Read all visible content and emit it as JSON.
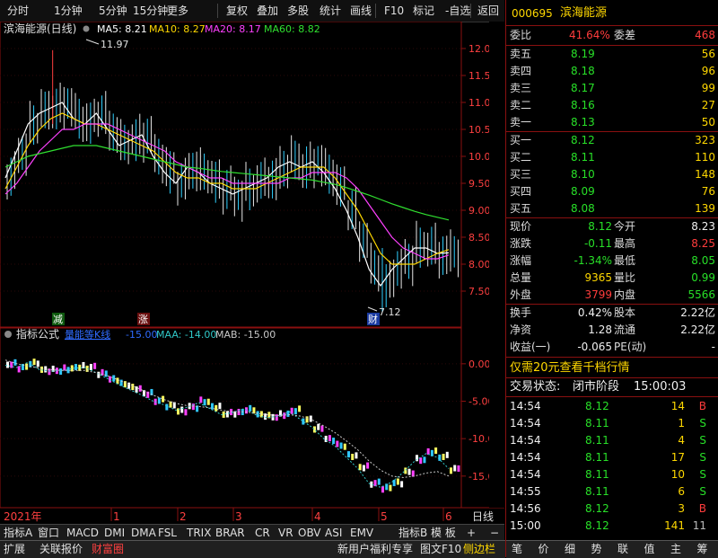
{
  "toolbar": {
    "items": [
      "分时",
      "1分钟",
      "5分钟",
      "15分钟",
      "更多",
      "复权",
      "叠加",
      "多股",
      "统计",
      "画线",
      "F10",
      "标记",
      "-自选",
      "返回"
    ]
  },
  "main_chart": {
    "title": "滨海能源(日线)",
    "ma": [
      {
        "label": "MA5: 8.21",
        "color": "#ffffff"
      },
      {
        "label": "MA10: 8.27",
        "color": "#ffd800"
      },
      {
        "label": "MA20: 8.17",
        "color": "#ff40ff"
      },
      {
        "label": "MA60: 8.82",
        "color": "#30e030"
      }
    ],
    "high_label": "11.97",
    "low_label": "7.12",
    "y_ticks": [
      "12.00",
      "11.50",
      "11.00",
      "10.50",
      "10.00",
      "9.50",
      "9.00",
      "8.50",
      "8.00",
      "7.50"
    ],
    "markers": {
      "jian": "减",
      "zhang": "涨",
      "cai": "财"
    }
  },
  "indicator_chart": {
    "title": "指标公式",
    "name": "量能等K线",
    "vals": [
      {
        "label": "-15.00",
        "color": "#2f6bff"
      },
      {
        "label": "MAA: -14.00",
        "color": "#30c8c8"
      },
      {
        "label": "MAB: -15.00",
        "color": "#c8c8c8"
      }
    ],
    "y_ticks": [
      "0.00",
      "-5.00",
      "-10.00",
      "-15.00"
    ]
  },
  "time_axis": {
    "year": "2021年",
    "months": [
      "1",
      "2",
      "3",
      "4",
      "5",
      "6"
    ],
    "right": "日线"
  },
  "bottom_tabs": [
    "指标A",
    "窗口",
    "MACD",
    "DMI",
    "DMA",
    "FSL",
    "TRIX",
    "BRAR",
    "CR",
    "VR",
    "OBV",
    "ASI",
    "EMV",
    "指标B",
    "模 板",
    "+",
    "−"
  ],
  "quote": {
    "code": "000695",
    "name": "滨海能源",
    "weibi_label": "委比",
    "weibi": "41.64%",
    "weicha_label": "委差",
    "weicha": "468",
    "sell": [
      {
        "label": "卖五",
        "price": "8.19",
        "vol": "56"
      },
      {
        "label": "卖四",
        "price": "8.18",
        "vol": "96"
      },
      {
        "label": "卖三",
        "price": "8.17",
        "vol": "99"
      },
      {
        "label": "卖二",
        "price": "8.16",
        "vol": "27"
      },
      {
        "label": "卖一",
        "price": "8.13",
        "vol": "50"
      }
    ],
    "buy": [
      {
        "label": "买一",
        "price": "8.12",
        "vol": "323"
      },
      {
        "label": "买二",
        "price": "8.11",
        "vol": "110"
      },
      {
        "label": "买三",
        "price": "8.10",
        "vol": "148"
      },
      {
        "label": "买四",
        "price": "8.09",
        "vol": "76"
      },
      {
        "label": "买五",
        "price": "8.08",
        "vol": "139"
      }
    ],
    "stats": [
      {
        "l1": "现价",
        "v1": "8.12",
        "c1": "green",
        "l2": "今开",
        "v2": "8.23",
        "c2": "white"
      },
      {
        "l1": "涨跌",
        "v1": "-0.11",
        "c1": "green",
        "l2": "最高",
        "v2": "8.25",
        "c2": "red"
      },
      {
        "l1": "涨幅",
        "v1": "-1.34%",
        "c1": "green",
        "l2": "最低",
        "v2": "8.05",
        "c2": "green"
      },
      {
        "l1": "总量",
        "v1": "9365",
        "c1": "yellow",
        "l2": "量比",
        "v2": "0.99",
        "c2": "green"
      },
      {
        "l1": "外盘",
        "v1": "3799",
        "c1": "red",
        "l2": "内盘",
        "v2": "5566",
        "c2": "green"
      }
    ],
    "fin": [
      {
        "l1": "换手",
        "v1": "0.42%",
        "l2": "股本",
        "v2": "2.22亿"
      },
      {
        "l1": "净资",
        "v1": "1.28",
        "l2": "流通",
        "v2": "2.22亿"
      },
      {
        "l1": "收益(一)",
        "v1": "-0.065",
        "l2": "PE(动)",
        "v2": "-"
      }
    ],
    "promo": "仅需20元查看千档行情",
    "trade_status_label": "交易状态:",
    "trade_status": "闭市阶段",
    "trade_time": "15:00:03",
    "ticks": [
      {
        "t": "14:54",
        "p": "8.12",
        "v": "14",
        "bs": "B"
      },
      {
        "t": "14:54",
        "p": "8.11",
        "v": "1",
        "bs": "S"
      },
      {
        "t": "14:54",
        "p": "8.11",
        "v": "4",
        "bs": "S"
      },
      {
        "t": "14:54",
        "p": "8.11",
        "v": "17",
        "bs": "S"
      },
      {
        "t": "14:54",
        "p": "8.11",
        "v": "10",
        "bs": "S"
      },
      {
        "t": "14:55",
        "p": "8.11",
        "v": "6",
        "bs": "S"
      },
      {
        "t": "14:56",
        "p": "8.12",
        "v": "3",
        "bs": "B"
      },
      {
        "t": "15:00",
        "p": "8.12",
        "v": "141",
        "bs": "11"
      }
    ],
    "bottom_icons": [
      "笔",
      "价",
      "细",
      "势",
      "联",
      "值",
      "主",
      "筹"
    ]
  },
  "status_bar": {
    "left": [
      "扩展",
      "关联报价",
      "财富圈"
    ],
    "right": [
      "新用户福利专享",
      "图文F10",
      "侧边栏"
    ]
  },
  "chart_data": [
    {
      "type": "line",
      "title": "滨海能源(日线)",
      "series": [
        {
          "name": "MA5",
          "values": [
            9.6,
            10.1,
            10.6,
            10.8,
            10.9,
            11.0,
            10.7,
            10.6,
            10.8,
            10.5,
            10.2,
            10.3,
            10.4,
            10.0,
            9.7,
            9.5,
            9.8,
            9.7,
            9.5,
            9.4,
            9.3,
            9.4,
            9.5,
            9.6,
            9.8,
            9.9,
            9.8,
            9.9,
            9.7,
            9.4,
            9.0,
            8.5,
            7.9,
            7.6,
            7.9,
            8.1,
            8.3,
            8.3,
            8.2,
            8.21
          ]
        },
        {
          "name": "MA10",
          "values": [
            9.4,
            9.8,
            10.2,
            10.5,
            10.7,
            10.8,
            10.7,
            10.6,
            10.6,
            10.5,
            10.4,
            10.3,
            10.2,
            10.1,
            9.9,
            9.7,
            9.6,
            9.6,
            9.5,
            9.5,
            9.4,
            9.4,
            9.4,
            9.5,
            9.6,
            9.7,
            9.8,
            9.8,
            9.8,
            9.6,
            9.3,
            9.0,
            8.6,
            8.2,
            8.0,
            8.0,
            8.0,
            8.1,
            8.2,
            8.27
          ]
        },
        {
          "name": "MA20",
          "values": [
            9.3,
            9.5,
            9.8,
            10.1,
            10.3,
            10.5,
            10.5,
            10.6,
            10.6,
            10.6,
            10.5,
            10.4,
            10.3,
            10.2,
            10.1,
            9.9,
            9.8,
            9.7,
            9.6,
            9.6,
            9.5,
            9.5,
            9.5,
            9.5,
            9.5,
            9.6,
            9.6,
            9.7,
            9.7,
            9.7,
            9.6,
            9.4,
            9.1,
            8.8,
            8.5,
            8.3,
            8.2,
            8.1,
            8.1,
            8.17
          ]
        },
        {
          "name": "MA60",
          "values": [
            9.8,
            9.9,
            10.0,
            10.05,
            10.1,
            10.15,
            10.2,
            10.2,
            10.2,
            10.15,
            10.1,
            10.05,
            10.0,
            9.95,
            9.9,
            9.85,
            9.8,
            9.78,
            9.75,
            9.72,
            9.7,
            9.68,
            9.66,
            9.64,
            9.62,
            9.6,
            9.58,
            9.56,
            9.52,
            9.48,
            9.42,
            9.35,
            9.28,
            9.2,
            9.12,
            9.05,
            8.98,
            8.92,
            8.87,
            8.82
          ]
        }
      ],
      "ylim": [
        7.0,
        12.2
      ],
      "annotations": [
        "11.97",
        "7.12"
      ]
    },
    {
      "type": "line",
      "title": "量能等K线",
      "series": [
        {
          "name": "MAA",
          "values": [
            -0.2,
            -0.5,
            0.2,
            -0.8,
            -1.0,
            -0.9,
            -0.6,
            -0.5,
            -1.2,
            -2.0,
            -2.8,
            -3.5,
            -4.2,
            -5.0,
            -5.5,
            -6.2,
            -5.8,
            -5.2,
            -6.0,
            -6.8,
            -6.5,
            -6.0,
            -6.8,
            -7.2,
            -7.0,
            -6.4,
            -7.5,
            -8.5,
            -10.0,
            -11.0,
            -12.5,
            -14.0,
            -16.0,
            -16.5,
            -15.8,
            -14.5,
            -13.0,
            -12.0,
            -12.5,
            -14.0
          ]
        },
        {
          "name": "MAB",
          "values": [
            0.5,
            0.0,
            -0.3,
            -0.6,
            -0.8,
            -0.9,
            -0.9,
            -0.9,
            -1.2,
            -1.6,
            -2.2,
            -2.8,
            -3.5,
            -4.2,
            -4.8,
            -5.3,
            -5.6,
            -5.7,
            -5.9,
            -6.2,
            -6.4,
            -6.4,
            -6.6,
            -6.8,
            -6.9,
            -6.8,
            -7.0,
            -7.5,
            -8.3,
            -9.2,
            -10.3,
            -11.5,
            -13.0,
            -14.2,
            -15.0,
            -15.2,
            -15.0,
            -14.6,
            -14.4,
            -15.0
          ]
        }
      ],
      "ylim": [
        -18.5,
        2.5
      ]
    }
  ]
}
